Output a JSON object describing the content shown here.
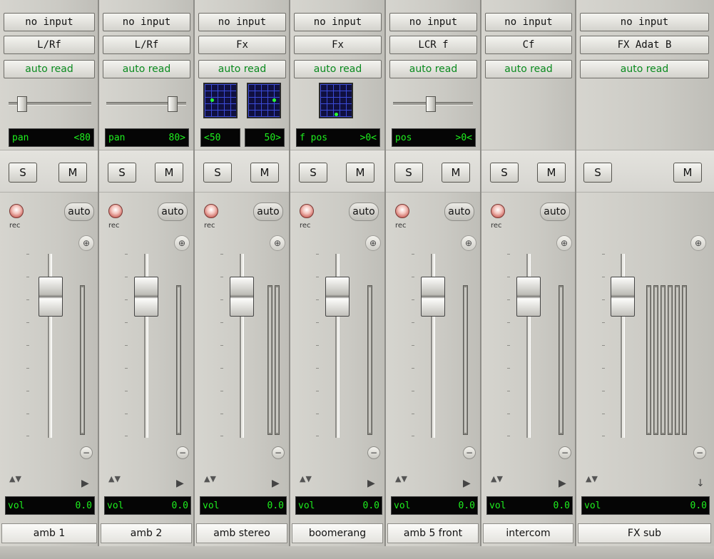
{
  "strips": [
    {
      "input": "no input",
      "output": "L/Rf",
      "automation": "auto read",
      "pan_label": "pan",
      "pan_value": "<80",
      "solo": "S",
      "mute": "M",
      "rec_label": "rec",
      "auto_label": "auto",
      "fader_symbol": "⊕",
      "volume_label": "vol",
      "volume_value": "0.0",
      "name": "amb 1"
    },
    {
      "input": "no input",
      "output": "L/Rf",
      "automation": "auto read",
      "pan_label": "pan",
      "pan_value": "80>",
      "solo": "S",
      "mute": "M",
      "rec_label": "rec",
      "auto_label": "auto",
      "fader_symbol": "⊕",
      "volume_label": "vol",
      "volume_value": "0.0",
      "name": "amb 2"
    },
    {
      "input": "no input",
      "output": "Fx",
      "automation": "auto read",
      "pan_left": "<50",
      "pan_right": "50>",
      "solo": "S",
      "mute": "M",
      "rec_label": "rec",
      "auto_label": "auto",
      "fader_symbol": "⊕",
      "volume_label": "vol",
      "volume_value": "0.0",
      "name": "amb stereo"
    },
    {
      "input": "no input",
      "output": "Fx",
      "automation": "auto read",
      "pan_label": "f pos",
      "pan_value": ">0<",
      "solo": "S",
      "mute": "M",
      "rec_label": "rec",
      "auto_label": "auto",
      "fader_symbol": "⊕",
      "volume_label": "vol",
      "volume_value": "0.0",
      "name": "boomerang"
    },
    {
      "input": "no input",
      "output": "LCR f",
      "automation": "auto read",
      "pan_label": "pos",
      "pan_value": ">0<",
      "solo": "S",
      "mute": "M",
      "rec_label": "rec",
      "auto_label": "auto",
      "fader_symbol": "⊕",
      "volume_label": "vol",
      "volume_value": "0.0",
      "name": "amb 5 front"
    },
    {
      "input": "no input",
      "output": "Cf",
      "automation": "auto read",
      "solo": "S",
      "mute": "M",
      "rec_label": "rec",
      "auto_label": "auto",
      "fader_symbol": "⊕",
      "volume_label": "vol",
      "volume_value": "0.0",
      "name": "intercom"
    },
    {
      "input": "no input",
      "output": "FX Adat B",
      "automation": "auto read",
      "solo": "S",
      "mute": "M",
      "fader_symbol": "⊕",
      "volume_label": "vol",
      "volume_value": "0.0",
      "name": "FX sub"
    }
  ],
  "minus_symbol": "−",
  "updown_symbol": "▲▼",
  "output_arrow": "▶",
  "down_arrow": "↓"
}
